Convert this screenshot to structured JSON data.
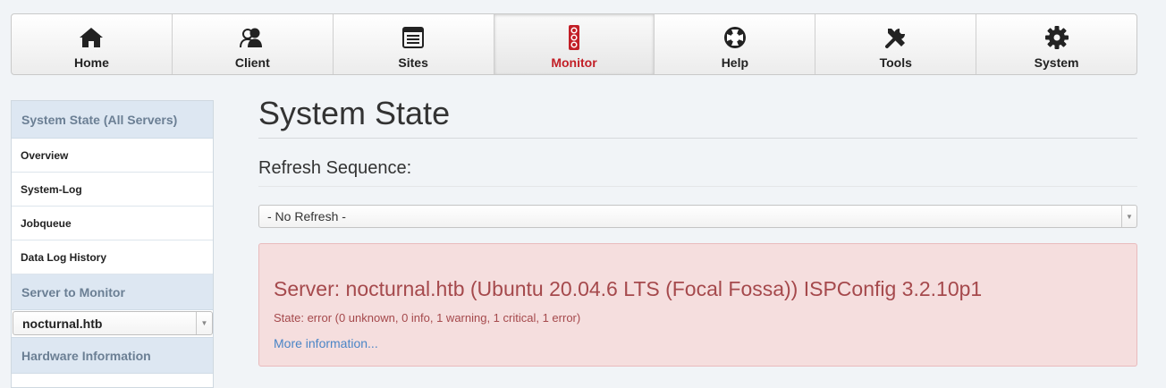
{
  "nav": {
    "items": [
      {
        "label": "Home",
        "icon": "home-icon"
      },
      {
        "label": "Client",
        "icon": "client-icon"
      },
      {
        "label": "Sites",
        "icon": "sites-icon"
      },
      {
        "label": "Monitor",
        "icon": "monitor-icon",
        "active": true
      },
      {
        "label": "Help",
        "icon": "help-icon"
      },
      {
        "label": "Tools",
        "icon": "tools-icon"
      },
      {
        "label": "System",
        "icon": "system-icon"
      }
    ],
    "active_color": "#c21f27"
  },
  "sidebar": {
    "section1_title": "System State (All Servers)",
    "items": [
      {
        "label": "Overview"
      },
      {
        "label": "System-Log"
      },
      {
        "label": "Jobqueue"
      },
      {
        "label": "Data Log History"
      }
    ],
    "section2_title": "Server to Monitor",
    "server_select_value": "nocturnal.htb",
    "section3_title": "Hardware Information"
  },
  "main": {
    "title": "System State",
    "refresh_label": "Refresh Sequence:",
    "refresh_value": "- No Refresh -",
    "alert": {
      "title": "Server: nocturnal.htb (Ubuntu 20.04.6 LTS (Focal Fossa)) ISPConfig 3.2.10p1",
      "state": "State: error (0 unknown, 0 info, 1 warning, 1 critical, 1 error)",
      "link": "More information..."
    }
  }
}
